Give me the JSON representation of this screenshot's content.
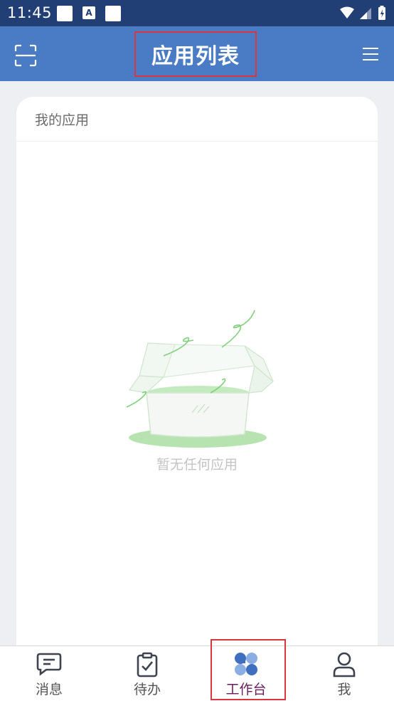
{
  "status_bar": {
    "time": "11:45"
  },
  "header": {
    "title": "应用列表",
    "scan_icon": "scan-icon",
    "menu_icon": "menu-icon"
  },
  "card": {
    "section_title": "我的应用",
    "empty_text": "暂无任何应用"
  },
  "tabs": [
    {
      "label": "消息",
      "icon": "message-icon"
    },
    {
      "label": "待办",
      "icon": "clipboard-check-icon"
    },
    {
      "label": "工作台",
      "icon": "workbench-icon",
      "active": true
    },
    {
      "label": "我",
      "icon": "user-icon"
    }
  ],
  "colors": {
    "header": "#4a7cc6",
    "status_bar": "#213f75",
    "active_tab": "#6a1b5b",
    "highlight": "#d9363e"
  }
}
